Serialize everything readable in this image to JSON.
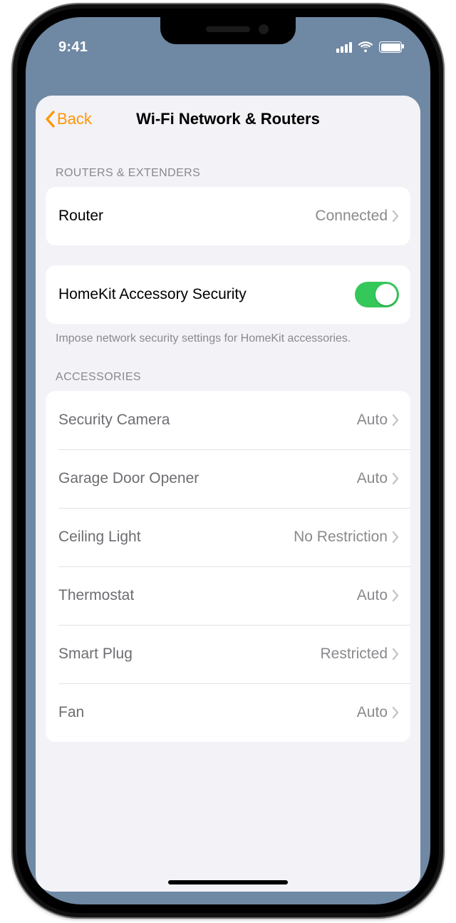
{
  "status": {
    "time": "9:41"
  },
  "nav": {
    "back": "Back",
    "title": "Wi-Fi Network & Routers"
  },
  "sections": {
    "routers": {
      "header": "ROUTERS & EXTENDERS",
      "row": {
        "label": "Router",
        "value": "Connected"
      }
    },
    "security": {
      "row": {
        "label": "HomeKit Accessory Security",
        "on": true
      },
      "footer": "Impose network security settings for HomeKit accessories."
    },
    "accessories": {
      "header": "ACCESSORIES",
      "items": [
        {
          "label": "Security Camera",
          "value": "Auto"
        },
        {
          "label": "Garage Door Opener",
          "value": "Auto"
        },
        {
          "label": "Ceiling Light",
          "value": "No Restriction"
        },
        {
          "label": "Thermostat",
          "value": "Auto"
        },
        {
          "label": "Smart Plug",
          "value": "Restricted"
        },
        {
          "label": "Fan",
          "value": "Auto"
        }
      ]
    }
  }
}
